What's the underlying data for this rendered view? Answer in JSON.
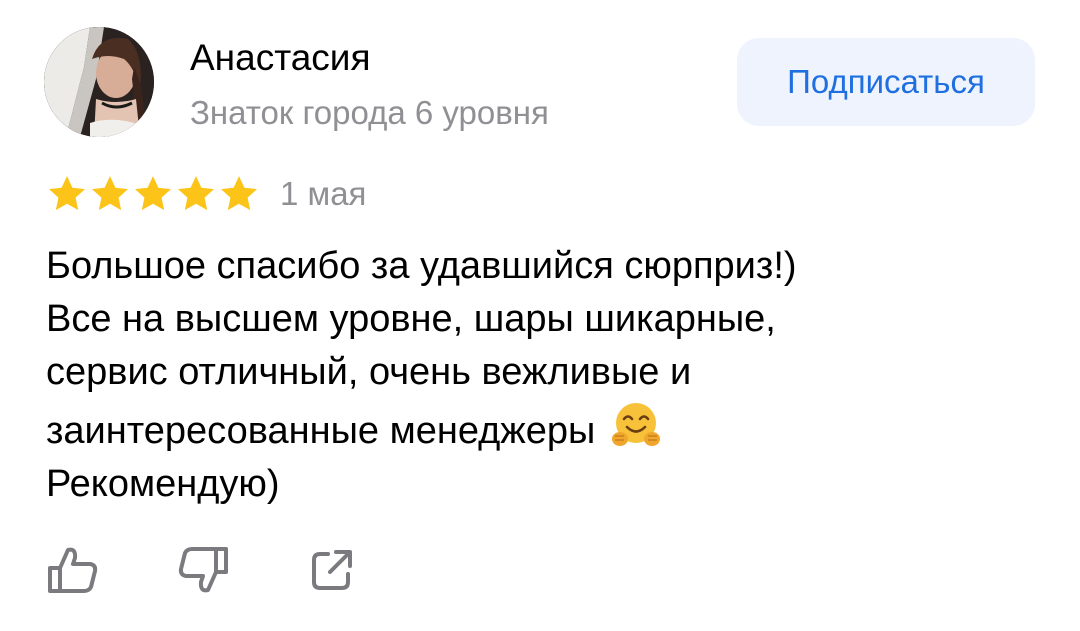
{
  "review": {
    "author": {
      "name": "Анастасия",
      "level": "Знаток города 6 уровня",
      "avatar_icon": "user-photo"
    },
    "subscribe_label": "Подписаться",
    "rating": {
      "stars": 5,
      "max": 5,
      "color": "#fcc419"
    },
    "date": "1 мая",
    "text_lines": [
      "Большое спасибо за удавшийся сюрприз!)",
      "Все на высшем уровне, шары шикарные,",
      "сервис отличный, очень вежливые и",
      "заинтересованные менеджеры",
      "Рекомендую)"
    ],
    "emoji": "hugging-face-emoji",
    "actions": {
      "like_icon": "thumbs-up-icon",
      "dislike_icon": "thumbs-down-icon",
      "share_icon": "share-icon"
    }
  },
  "colors": {
    "accent": "#1f6fe0",
    "button_bg": "#eef3fd",
    "secondary_text": "#8f8f94",
    "icon": "#7a7a7f",
    "star": "#fcc419"
  }
}
